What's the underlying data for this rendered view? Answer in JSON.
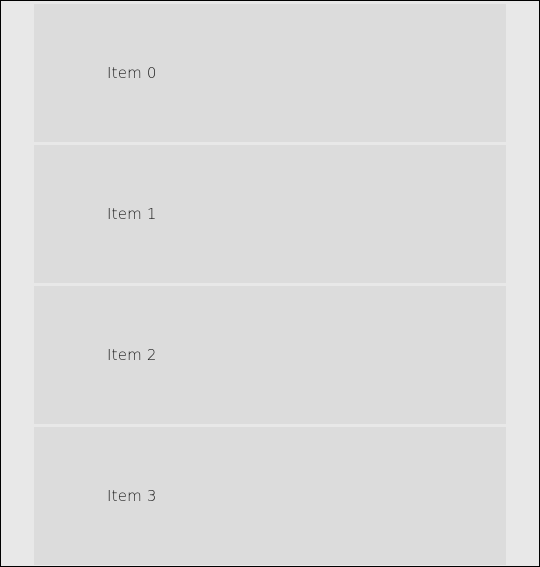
{
  "list": {
    "items": [
      {
        "label": "Item 0"
      },
      {
        "label": "Item 1"
      },
      {
        "label": "Item 2"
      },
      {
        "label": "Item 3"
      }
    ]
  }
}
